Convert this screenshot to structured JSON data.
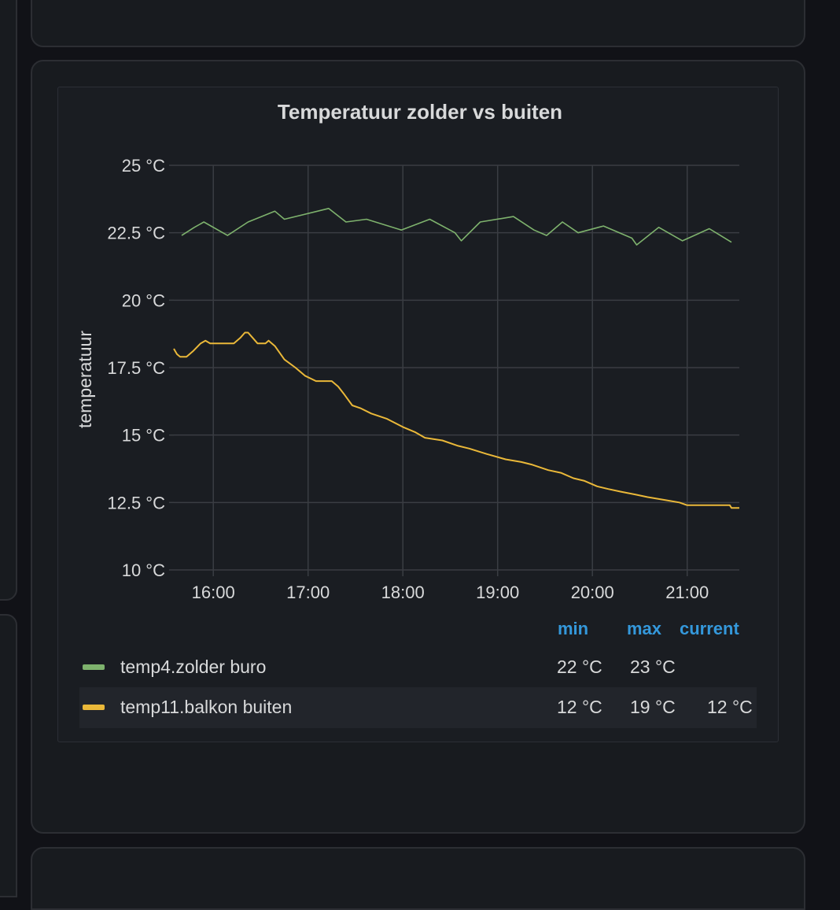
{
  "chart_data": {
    "type": "line",
    "title": "Temperatuur zolder vs buiten",
    "ylabel": "temperatuur",
    "xlabel": "",
    "ylim": [
      10,
      25
    ],
    "xlim": [
      "15:35",
      "21:33"
    ],
    "grid": true,
    "y_ticks": [
      "25 °C",
      "22.5 °C",
      "20 °C",
      "17.5 °C",
      "15 °C",
      "12.5 °C",
      "10 °C"
    ],
    "y_tick_values": [
      25,
      22.5,
      20,
      17.5,
      15,
      12.5,
      10
    ],
    "x_ticks": [
      "16:00",
      "17:00",
      "18:00",
      "19:00",
      "20:00",
      "21:00"
    ],
    "series": [
      {
        "name": "temp4.zolder buro",
        "color": "#7eb26d",
        "points": [
          [
            "15:40",
            22.4
          ],
          [
            "15:48",
            22.7
          ],
          [
            "15:54",
            22.9
          ],
          [
            "16:09",
            22.4
          ],
          [
            "16:22",
            22.9
          ],
          [
            "16:39",
            23.3
          ],
          [
            "16:45",
            23.0
          ],
          [
            "17:13",
            23.4
          ],
          [
            "17:24",
            22.9
          ],
          [
            "17:37",
            23.0
          ],
          [
            "17:59",
            22.6
          ],
          [
            "18:17",
            23.0
          ],
          [
            "18:33",
            22.5
          ],
          [
            "18:37",
            22.2
          ],
          [
            "18:49",
            22.9
          ],
          [
            "19:10",
            23.1
          ],
          [
            "19:23",
            22.6
          ],
          [
            "19:31",
            22.4
          ],
          [
            "19:41",
            22.9
          ],
          [
            "19:51",
            22.5
          ],
          [
            "20:07",
            22.75
          ],
          [
            "20:25",
            22.3
          ],
          [
            "20:28",
            22.05
          ],
          [
            "20:42",
            22.7
          ],
          [
            "20:57",
            22.2
          ],
          [
            "21:14",
            22.65
          ],
          [
            "21:21",
            22.4
          ],
          [
            "21:28",
            22.15
          ]
        ]
      },
      {
        "name": "temp11.balkon buiten",
        "color": "#eab839",
        "points": [
          [
            "15:35",
            18.2
          ],
          [
            "15:37",
            18.0
          ],
          [
            "15:39",
            17.9
          ],
          [
            "15:43",
            17.9
          ],
          [
            "15:47",
            18.1
          ],
          [
            "15:52",
            18.4
          ],
          [
            "15:55",
            18.5
          ],
          [
            "15:58",
            18.4
          ],
          [
            "16:13",
            18.4
          ],
          [
            "16:17",
            18.6
          ],
          [
            "16:20",
            18.8
          ],
          [
            "16:22",
            18.8
          ],
          [
            "16:25",
            18.6
          ],
          [
            "16:28",
            18.4
          ],
          [
            "16:33",
            18.4
          ],
          [
            "16:35",
            18.5
          ],
          [
            "16:39",
            18.3
          ],
          [
            "16:45",
            17.8
          ],
          [
            "16:52",
            17.5
          ],
          [
            "16:58",
            17.2
          ],
          [
            "17:05",
            17.0
          ],
          [
            "17:15",
            17.0
          ],
          [
            "17:19",
            16.8
          ],
          [
            "17:23",
            16.5
          ],
          [
            "17:28",
            16.1
          ],
          [
            "17:33",
            16.0
          ],
          [
            "17:40",
            15.8
          ],
          [
            "17:50",
            15.6
          ],
          [
            "18:00",
            15.3
          ],
          [
            "18:08",
            15.1
          ],
          [
            "18:14",
            14.9
          ],
          [
            "18:25",
            14.8
          ],
          [
            "18:35",
            14.6
          ],
          [
            "18:42",
            14.5
          ],
          [
            "18:53",
            14.3
          ],
          [
            "19:05",
            14.1
          ],
          [
            "19:15",
            14.0
          ],
          [
            "19:22",
            13.9
          ],
          [
            "19:32",
            13.7
          ],
          [
            "19:40",
            13.6
          ],
          [
            "19:48",
            13.4
          ],
          [
            "19:55",
            13.3
          ],
          [
            "20:03",
            13.1
          ],
          [
            "20:10",
            13.0
          ],
          [
            "20:18",
            12.9
          ],
          [
            "20:27",
            12.8
          ],
          [
            "20:35",
            12.7
          ],
          [
            "20:45",
            12.6
          ],
          [
            "20:55",
            12.5
          ],
          [
            "21:00",
            12.4
          ],
          [
            "21:15",
            12.4
          ],
          [
            "21:27",
            12.4
          ],
          [
            "21:28",
            12.3
          ],
          [
            "21:33",
            12.3
          ]
        ]
      }
    ]
  },
  "legend": {
    "headers": {
      "min": "min",
      "max": "max",
      "current": "current"
    },
    "rows": [
      {
        "name": "temp4.zolder buro",
        "color": "#7eb26d",
        "min": "22 °C",
        "max": "23 °C",
        "current": ""
      },
      {
        "name": "temp11.balkon buiten",
        "color": "#eab839",
        "min": "12 °C",
        "max": "19 °C",
        "current": "12 °C"
      }
    ]
  }
}
